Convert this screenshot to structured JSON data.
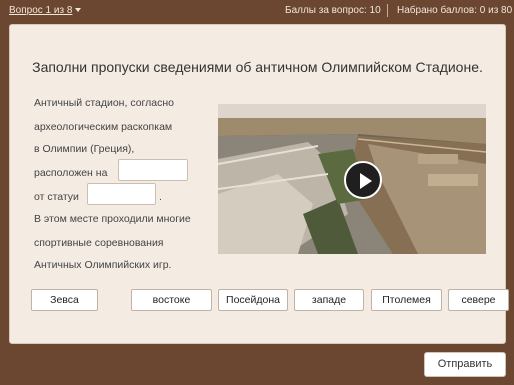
{
  "topbar": {
    "question_nav": "Вопрос 1 из 8",
    "points_per_question": "Баллы за вопрос: 10",
    "total_points": "Набрано баллов: 0 из 80"
  },
  "question": {
    "title": "Заполни пропуски сведениями об античном Олимпийском Стадионе.",
    "text_lines": [
      "Античный стадион, согласно",
      "археологическим раскопкам",
      "в Олимпии (Греция),",
      "расположен на",
      "от статуи",
      ".",
      "В этом месте проходили многие",
      "спортивные соревнования",
      "Античных Олимпийских игр."
    ],
    "blanks": [
      "",
      ""
    ]
  },
  "options": [
    "Зевса",
    "востоке",
    "Посейдона",
    "западе",
    "Птолемея",
    "севере"
  ],
  "submit_label": "Отправить"
}
